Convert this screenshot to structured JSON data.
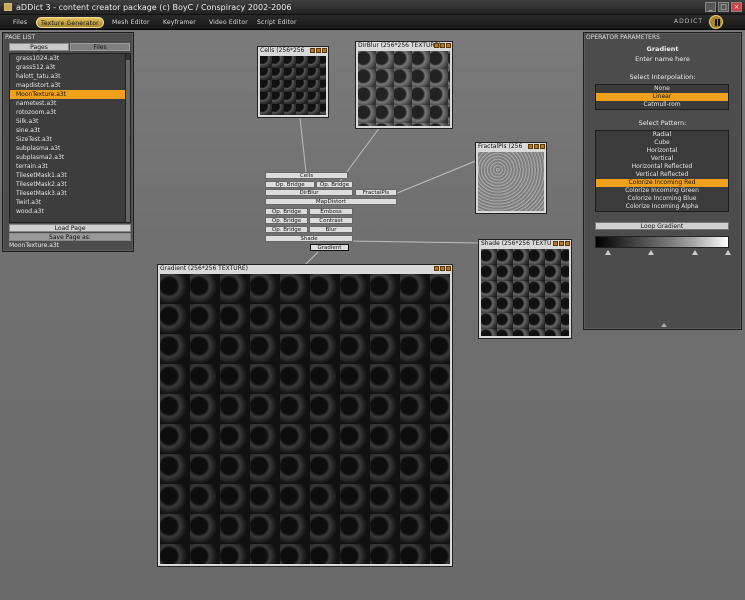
{
  "window": {
    "title": "aDDict 3 - content creator package (c) BoyC / Conspiracy 2002-2006",
    "logo": "ADDICT"
  },
  "menu": [
    "Files",
    "Texture Generator",
    "Mesh Editor",
    "Keyframer",
    "Video Editor",
    "Script Editor"
  ],
  "page_list": {
    "title": "PAGE LIST",
    "tabs": [
      "Pages",
      "Files"
    ],
    "files": [
      "grass1024.a3t",
      "grass512.a3t",
      "halott_tatu.a3t",
      "mapdistort.a3t",
      "MoonTexture.a3t",
      "nametest.a3t",
      "rotozoom.a3t",
      "Silk.a3t",
      "sine.a3t",
      "SizeTest.a3t",
      "subplasma.a3t",
      "subplasma2.a3t",
      "terrain.a3t",
      "TilesetMask1.a3t",
      "TilesetMask2.a3t",
      "TilesetMask3.a3t",
      "Twirl.a3t",
      "wood.a3t"
    ],
    "load_button": "Load Page",
    "save_button": "Save Page as:",
    "page_name": "MoonTexture.a3t"
  },
  "textures": {
    "cells": "Cells (256*256",
    "dirblur": "DirBlur (256*256 TEXTURE)",
    "fractal": "FractalPls (256",
    "shade": "Shade (256*256 TEXTU",
    "gradient": "Gradient (256*256 TEXTURE)"
  },
  "nodes": {
    "cells": "Cells",
    "op1": "Op. Bridge",
    "op2": "Op. Bridge",
    "dirblur": "DirBlur",
    "fractal": "FractalPls",
    "mapdistort": "MapDistort",
    "op3": "Op. Bridge",
    "emboss": "Emboss",
    "op4": "Op. Bridge",
    "contrast": "Contrast",
    "op5": "Op. Bridge",
    "blur": "Blur",
    "shade": "Shade",
    "gradient": "Gradient"
  },
  "params": {
    "title": "OPERATOR PARAMETERS",
    "operator": "Gradient",
    "name_prompt": "Enter name here",
    "interp_label": "Select Interpolation:",
    "interp_options": [
      "None",
      "Linear",
      "Catmull-rom"
    ],
    "interp_selected": 1,
    "pattern_label": "Select Pattern:",
    "pattern_options": [
      "Radial",
      "Cube",
      "Horizontal",
      "Vertical",
      "Horizontal Reflected",
      "Vertical Reflected",
      "Colorize Incoming Red",
      "Colorize Incoming Green",
      "Colorize Incoming Blue",
      "Colorize Incoming Alpha"
    ],
    "pattern_selected": 6,
    "loop_button": "Loop Gradient"
  }
}
